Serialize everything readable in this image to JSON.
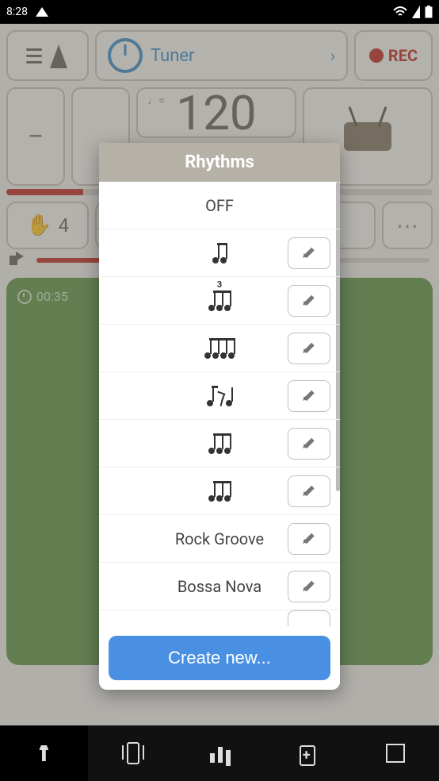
{
  "status": {
    "time": "8:28"
  },
  "header": {
    "tuner_label": "Tuner",
    "rec_label": "REC"
  },
  "tempo": {
    "unit_label": "♩=",
    "bpm": "120"
  },
  "meter": {
    "beats": "4"
  },
  "playback": {
    "time": "00:35"
  },
  "dialog": {
    "title": "Rhythms",
    "off_label": "OFF",
    "items": [
      {
        "type": "icon",
        "icon": "eighth-pair"
      },
      {
        "type": "icon",
        "icon": "eighth-triplet"
      },
      {
        "type": "icon",
        "icon": "sixteenth-four"
      },
      {
        "type": "icon",
        "icon": "eighth-pair-rest"
      },
      {
        "type": "icon",
        "icon": "sixteenth-pair-a"
      },
      {
        "type": "icon",
        "icon": "sixteenth-pair-b"
      },
      {
        "type": "text",
        "label": "Rock Groove"
      },
      {
        "type": "text",
        "label": "Bossa Nova"
      }
    ],
    "create_label": "Create new..."
  }
}
